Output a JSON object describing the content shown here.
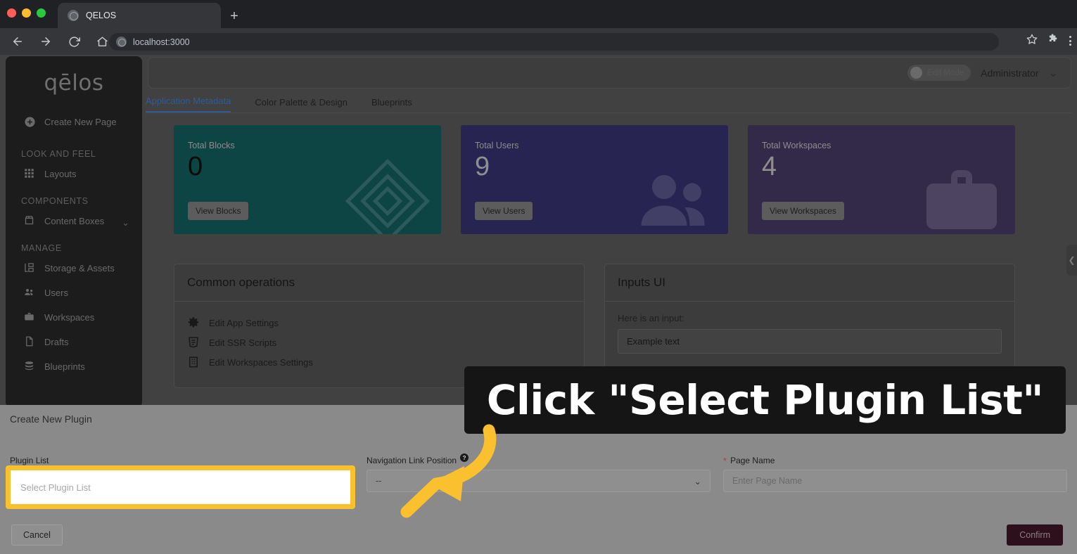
{
  "browser": {
    "tab_title": "QELOS",
    "new_tab_label": "+",
    "url": "localhost:3000",
    "back_icon": "back-arrow-icon",
    "forward_icon": "forward-arrow-icon",
    "reload_icon": "reload-icon",
    "home_icon": "home-icon",
    "bookmark_icon": "star-icon",
    "extensions_icon": "puzzle-icon",
    "menu_icon": "kebab-menu-icon"
  },
  "sidebar": {
    "brand": "qēlos",
    "create_label": "Create New Page",
    "groups": [
      {
        "label": "LOOK AND FEEL",
        "items": [
          {
            "label": "Layouts",
            "icon": "grid-icon"
          }
        ]
      },
      {
        "label": "COMPONENTS",
        "items": [
          {
            "label": "Content Boxes",
            "icon": "box-icon",
            "chevron": "⌄"
          }
        ]
      },
      {
        "label": "MANAGE",
        "items": [
          {
            "label": "Storage & Assets",
            "icon": "storage-icon"
          },
          {
            "label": "Users",
            "icon": "users-icon"
          },
          {
            "label": "Workspaces",
            "icon": "briefcase-icon"
          },
          {
            "label": "Drafts",
            "icon": "document-icon"
          },
          {
            "label": "Blueprints",
            "icon": "database-icon"
          }
        ]
      }
    ]
  },
  "topbar": {
    "edit_mode_label": "Edit Mode",
    "edit_mode_on": false,
    "user": "Administrator",
    "user_chevron": "⌄"
  },
  "tabs": [
    {
      "label": "Application Metadata",
      "active": true
    },
    {
      "label": "Color Palette & Design",
      "active": false
    },
    {
      "label": "Blueprints",
      "active": false
    }
  ],
  "cards": [
    {
      "title": "Total Blocks",
      "value": "0",
      "button": "View Blocks",
      "color": "#0d4444",
      "watermark": "blocks-icon"
    },
    {
      "title": "Total Users",
      "value": "9",
      "button": "View Users",
      "color": "#272452",
      "watermark": "users-icon"
    },
    {
      "title": "Total Workspaces",
      "value": "4",
      "button": "View Workspaces",
      "color": "#332a4a",
      "watermark": "briefcase-icon"
    }
  ],
  "panels": {
    "common_operations": {
      "title": "Common operations",
      "items": [
        {
          "label": "Edit App Settings",
          "icon": "gear-icon"
        },
        {
          "label": "Edit SSR Scripts",
          "icon": "html5-icon"
        },
        {
          "label": "Edit Workspaces Settings",
          "icon": "building-icon"
        }
      ]
    },
    "inputs_ui": {
      "title": "Inputs UI",
      "input_label": "Here is an input:",
      "input_value": "Example text"
    }
  },
  "collapse_handle_icon": "chevron-left-icon",
  "modal": {
    "title": "Create New Plugin",
    "close_icon": "close-icon",
    "fields": {
      "plugin_list": {
        "label": "Plugin List",
        "placeholder": "Select Plugin List",
        "required": false
      },
      "nav_position": {
        "label": "Navigation Link Position",
        "value": "--",
        "help_icon": "help-icon",
        "chevron": "⌄"
      },
      "page_name": {
        "label": "Page Name",
        "placeholder": "Enter Page Name",
        "required": true,
        "required_mark": "*"
      }
    },
    "cancel_label": "Cancel",
    "confirm_label": "Confirm"
  },
  "annotation": {
    "tooltip_text": "Click \"Select Plugin List\"",
    "highlight_color": "#FBC02D",
    "arrow_color": "#FBC02D",
    "arrow_icon": "curved-arrow-icon"
  }
}
